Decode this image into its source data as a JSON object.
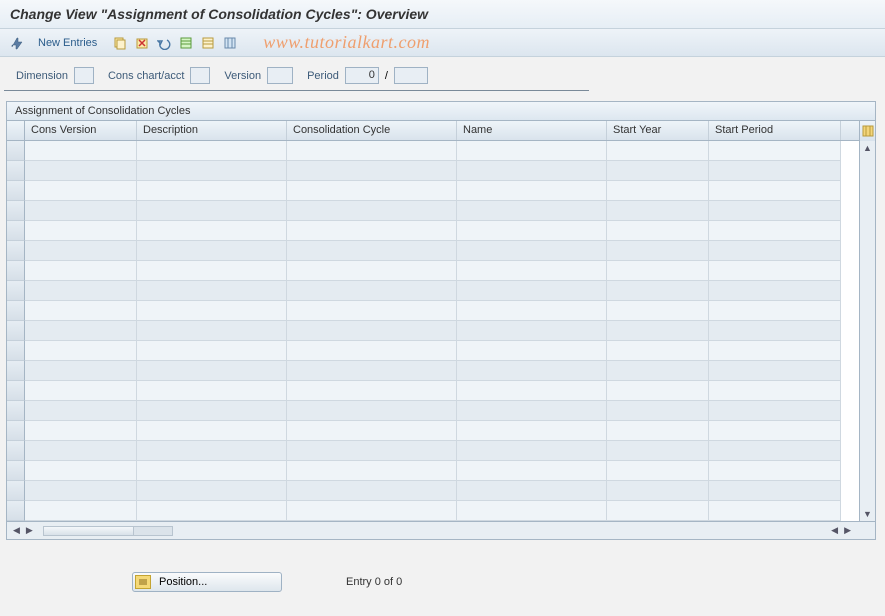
{
  "title": "Change View \"Assignment of Consolidation Cycles\": Overview",
  "toolbar": {
    "new_entries": "New Entries"
  },
  "watermark": "www.tutorialkart.com",
  "params": {
    "dimension_label": "Dimension",
    "dimension_value": "",
    "conschart_label": "Cons chart/acct",
    "conschart_value": "",
    "version_label": "Version",
    "version_value": "",
    "period_label": "Period",
    "period_value": "0",
    "period_sep": "/",
    "period_year": ""
  },
  "table": {
    "title": "Assignment of Consolidation Cycles",
    "columns": {
      "c1": "Cons Version",
      "c2": "Description",
      "c3": "Consolidation Cycle",
      "c4": "Name",
      "c5": "Start Year",
      "c6": "Start Period"
    }
  },
  "footer": {
    "position_label": "Position...",
    "entry_text": "Entry 0 of 0"
  }
}
